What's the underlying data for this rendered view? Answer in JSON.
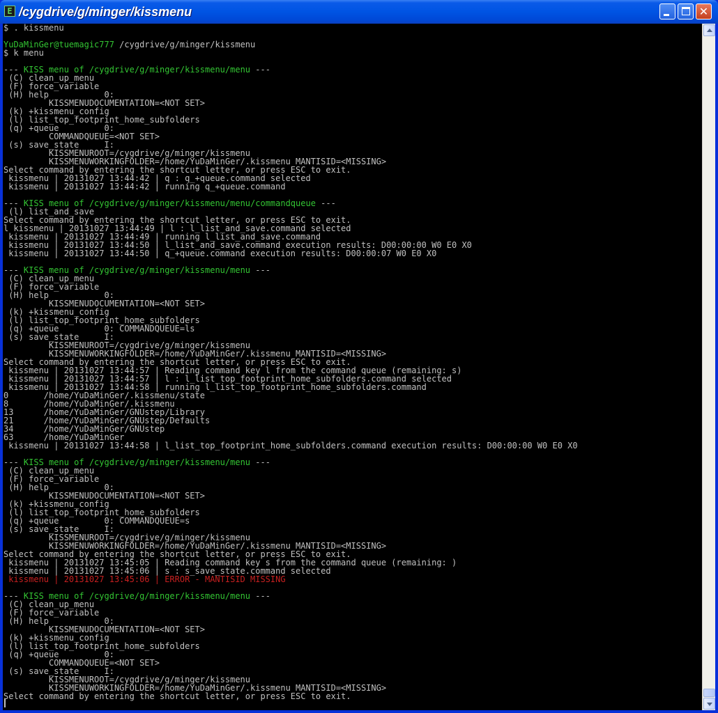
{
  "window": {
    "title": "/cygdrive/g/minger/kissmenu",
    "app_icon": "terminal-icon",
    "controls": {
      "minimize": "minimize-icon",
      "maximize": "maximize-icon",
      "close": "close-icon"
    }
  },
  "colors": {
    "background": "#000000",
    "text": "#c0c0c0",
    "green": "#33c533",
    "red": "#c82020",
    "titlebar": "#0054e3"
  },
  "console": {
    "lines": [
      {
        "segments": [
          {
            "t": "$ . kissmenu"
          }
        ]
      },
      {
        "segments": [
          {
            "t": ""
          }
        ]
      },
      {
        "segments": [
          {
            "t": "YuDaMinGer@tuemagic777",
            "c": "g"
          },
          {
            "t": " /cygdrive/g/minger/kissmenu"
          }
        ]
      },
      {
        "segments": [
          {
            "t": "$ k menu"
          }
        ]
      },
      {
        "segments": [
          {
            "t": ""
          }
        ]
      },
      {
        "segments": [
          {
            "t": "--- "
          },
          {
            "t": "KISS menu of /cygdrive/g/minger/kissmenu/menu",
            "c": "g"
          },
          {
            "t": " ---"
          }
        ]
      },
      {
        "segments": [
          {
            "t": " (C) clean_up_menu"
          }
        ]
      },
      {
        "segments": [
          {
            "t": " (F) force_variable"
          }
        ]
      },
      {
        "segments": [
          {
            "t": " (H) help           0:"
          }
        ]
      },
      {
        "segments": [
          {
            "t": "         KISSMENUDOCUMENTATION=<NOT SET>"
          }
        ]
      },
      {
        "segments": [
          {
            "t": " (k) +kissmenu_config"
          }
        ]
      },
      {
        "segments": [
          {
            "t": " (l) list_top_footprint_home_subfolders"
          }
        ]
      },
      {
        "segments": [
          {
            "t": " (q) +queue         0:"
          }
        ]
      },
      {
        "segments": [
          {
            "t": "         COMMANDQUEUE=<NOT SET>"
          }
        ]
      },
      {
        "segments": [
          {
            "t": " (s) save_state     I:"
          }
        ]
      },
      {
        "segments": [
          {
            "t": "         KISSMENUROOT=/cygdrive/g/minger/kissmenu"
          }
        ]
      },
      {
        "segments": [
          {
            "t": "         KISSMENUWORKINGFOLDER=/home/YuDaMinGer/.kissmenu MANTISID=<MISSING>"
          }
        ]
      },
      {
        "segments": [
          {
            "t": "Select command by entering the shortcut letter, or press ESC to exit."
          }
        ]
      },
      {
        "segments": [
          {
            "t": " kissmenu | 20131027 13:44:42 | q : q_+queue.command selected"
          }
        ]
      },
      {
        "segments": [
          {
            "t": " kissmenu | 20131027 13:44:42 | running q_+queue.command"
          }
        ]
      },
      {
        "segments": [
          {
            "t": ""
          }
        ]
      },
      {
        "segments": [
          {
            "t": "--- "
          },
          {
            "t": "KISS menu of /cygdrive/g/minger/kissmenu/menu/commandqueue",
            "c": "g"
          },
          {
            "t": " ---"
          }
        ]
      },
      {
        "segments": [
          {
            "t": " (l) list_and_save"
          }
        ]
      },
      {
        "segments": [
          {
            "t": "Select command by entering the shortcut letter, or press ESC to exit."
          }
        ]
      },
      {
        "segments": [
          {
            "t": "l kissmenu | 20131027 13:44:49 | l : l_list_and_save.command selected"
          }
        ]
      },
      {
        "segments": [
          {
            "t": " kissmenu | 20131027 13:44:49 | running l_list_and_save.command"
          }
        ]
      },
      {
        "segments": [
          {
            "t": " kissmenu | 20131027 13:44:50 | l_list_and_save.command execution results: D00:00:00 W0 E0 X0"
          }
        ]
      },
      {
        "segments": [
          {
            "t": " kissmenu | 20131027 13:44:50 | q_+queue.command execution results: D00:00:07 W0 E0 X0"
          }
        ]
      },
      {
        "segments": [
          {
            "t": ""
          }
        ]
      },
      {
        "segments": [
          {
            "t": "--- "
          },
          {
            "t": "KISS menu of /cygdrive/g/minger/kissmenu/menu",
            "c": "g"
          },
          {
            "t": " ---"
          }
        ]
      },
      {
        "segments": [
          {
            "t": " (C) clean_up_menu"
          }
        ]
      },
      {
        "segments": [
          {
            "t": " (F) force_variable"
          }
        ]
      },
      {
        "segments": [
          {
            "t": " (H) help           0:"
          }
        ]
      },
      {
        "segments": [
          {
            "t": "         KISSMENUDOCUMENTATION=<NOT SET>"
          }
        ]
      },
      {
        "segments": [
          {
            "t": " (k) +kissmenu_config"
          }
        ]
      },
      {
        "segments": [
          {
            "t": " (l) list_top_footprint_home_subfolders"
          }
        ]
      },
      {
        "segments": [
          {
            "t": " (q) +queue         0: COMMANDQUEUE=ls"
          }
        ]
      },
      {
        "segments": [
          {
            "t": " (s) save_state     I:"
          }
        ]
      },
      {
        "segments": [
          {
            "t": "         KISSMENUROOT=/cygdrive/g/minger/kissmenu"
          }
        ]
      },
      {
        "segments": [
          {
            "t": "         KISSMENUWORKINGFOLDER=/home/YuDaMinGer/.kissmenu MANTISID=<MISSING>"
          }
        ]
      },
      {
        "segments": [
          {
            "t": "Select command by entering the shortcut letter, or press ESC to exit."
          }
        ]
      },
      {
        "segments": [
          {
            "t": " kissmenu | 20131027 13:44:57 | Reading command key l from the command queue (remaining: s)"
          }
        ]
      },
      {
        "segments": [
          {
            "t": " kissmenu | 20131027 13:44:57 | l : l_list_top_footprint_home_subfolders.command selected"
          }
        ]
      },
      {
        "segments": [
          {
            "t": " kissmenu | 20131027 13:44:58 | running l_list_top_footprint_home_subfolders.command"
          }
        ]
      },
      {
        "segments": [
          {
            "t": "0       /home/YuDaMinGer/.kissmenu/state"
          }
        ]
      },
      {
        "segments": [
          {
            "t": "8       /home/YuDaMinGer/.kissmenu"
          }
        ]
      },
      {
        "segments": [
          {
            "t": "13      /home/YuDaMinGer/GNUstep/Library"
          }
        ]
      },
      {
        "segments": [
          {
            "t": "21      /home/YuDaMinGer/GNUstep/Defaults"
          }
        ]
      },
      {
        "segments": [
          {
            "t": "34      /home/YuDaMinGer/GNUstep"
          }
        ]
      },
      {
        "segments": [
          {
            "t": "63      /home/YuDaMinGer"
          }
        ]
      },
      {
        "segments": [
          {
            "t": " kissmenu | 20131027 13:44:58 | l_list_top_footprint_home_subfolders.command execution results: D00:00:00 W0 E0 X0"
          }
        ]
      },
      {
        "segments": [
          {
            "t": ""
          }
        ]
      },
      {
        "segments": [
          {
            "t": "--- "
          },
          {
            "t": "KISS menu of /cygdrive/g/minger/kissmenu/menu",
            "c": "g"
          },
          {
            "t": " ---"
          }
        ]
      },
      {
        "segments": [
          {
            "t": " (C) clean_up_menu"
          }
        ]
      },
      {
        "segments": [
          {
            "t": " (F) force_variable"
          }
        ]
      },
      {
        "segments": [
          {
            "t": " (H) help           0:"
          }
        ]
      },
      {
        "segments": [
          {
            "t": "         KISSMENUDOCUMENTATION=<NOT SET>"
          }
        ]
      },
      {
        "segments": [
          {
            "t": " (k) +kissmenu_config"
          }
        ]
      },
      {
        "segments": [
          {
            "t": " (l) list_top_footprint_home_subfolders"
          }
        ]
      },
      {
        "segments": [
          {
            "t": " (q) +queue         0: COMMANDQUEUE=s"
          }
        ]
      },
      {
        "segments": [
          {
            "t": " (s) save_state     I:"
          }
        ]
      },
      {
        "segments": [
          {
            "t": "         KISSMENUROOT=/cygdrive/g/minger/kissmenu"
          }
        ]
      },
      {
        "segments": [
          {
            "t": "         KISSMENUWORKINGFOLDER=/home/YuDaMinGer/.kissmenu MANTISID=<MISSING>"
          }
        ]
      },
      {
        "segments": [
          {
            "t": "Select command by entering the shortcut letter, or press ESC to exit."
          }
        ]
      },
      {
        "segments": [
          {
            "t": " kissmenu | 20131027 13:45:05 | Reading command key s from the command queue (remaining: )"
          }
        ]
      },
      {
        "segments": [
          {
            "t": " kissmenu | 20131027 13:45:06 | s : s_save_state.command selected"
          }
        ]
      },
      {
        "segments": [
          {
            "t": " kissmenu | 20131027 13:45:06 | ERROR - MANTISID MISSING",
            "c": "r"
          }
        ]
      },
      {
        "segments": [
          {
            "t": ""
          }
        ]
      },
      {
        "segments": [
          {
            "t": "--- "
          },
          {
            "t": "KISS menu of /cygdrive/g/minger/kissmenu/menu",
            "c": "g"
          },
          {
            "t": " ---"
          }
        ]
      },
      {
        "segments": [
          {
            "t": " (C) clean_up_menu"
          }
        ]
      },
      {
        "segments": [
          {
            "t": " (F) force_variable"
          }
        ]
      },
      {
        "segments": [
          {
            "t": " (H) help           0:"
          }
        ]
      },
      {
        "segments": [
          {
            "t": "         KISSMENUDOCUMENTATION=<NOT SET>"
          }
        ]
      },
      {
        "segments": [
          {
            "t": " (k) +kissmenu_config"
          }
        ]
      },
      {
        "segments": [
          {
            "t": " (l) list_top_footprint_home_subfolders"
          }
        ]
      },
      {
        "segments": [
          {
            "t": " (q) +queue         0:"
          }
        ]
      },
      {
        "segments": [
          {
            "t": "         COMMANDQUEUE=<NOT SET>"
          }
        ]
      },
      {
        "segments": [
          {
            "t": " (s) save_state     I:"
          }
        ]
      },
      {
        "segments": [
          {
            "t": "         KISSMENUROOT=/cygdrive/g/minger/kissmenu"
          }
        ]
      },
      {
        "segments": [
          {
            "t": "         KISSMENUWORKINGFOLDER=/home/YuDaMinGer/.kissmenu MANTISID=<MISSING>"
          }
        ]
      },
      {
        "segments": [
          {
            "t": "Select command by entering the shortcut letter, or press ESC to exit."
          }
        ]
      }
    ]
  }
}
